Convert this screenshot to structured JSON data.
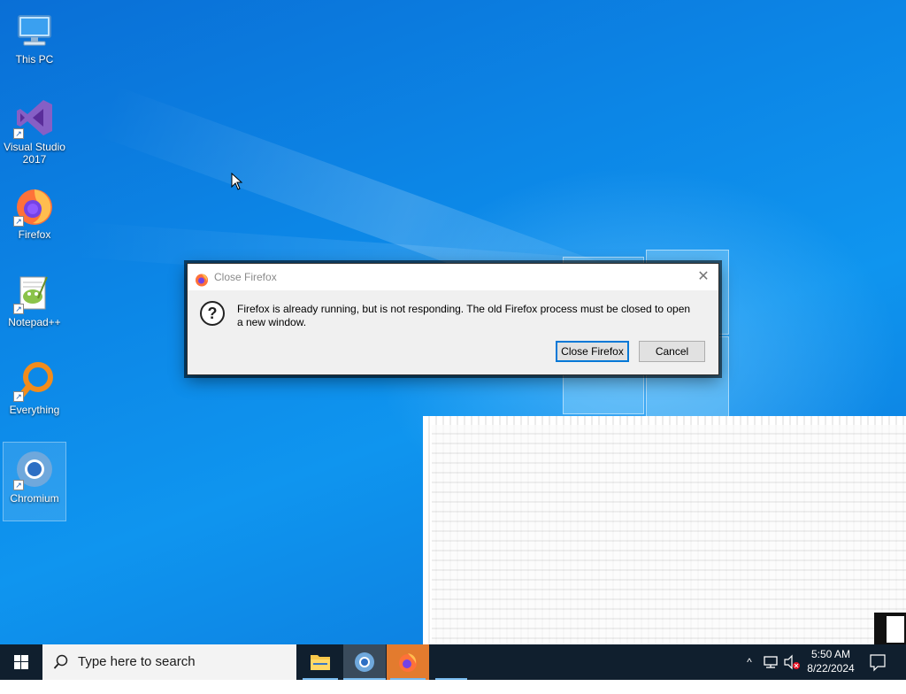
{
  "desktop": {
    "icons": [
      {
        "label": "This PC"
      },
      {
        "label": "Visual Studio 2017"
      },
      {
        "label": "Firefox"
      },
      {
        "label": "Notepad++"
      },
      {
        "label": "Everything"
      },
      {
        "label": "Chromium"
      }
    ]
  },
  "dialog": {
    "title": "Close Firefox",
    "message": "Firefox is already running, but is not responding. The old Firefox process must be closed to open a new window.",
    "primary_label": "Close Firefox",
    "cancel_label": "Cancel",
    "close_glyph": "✕",
    "question_glyph": "?"
  },
  "taskbar": {
    "search_placeholder": "Type here to search",
    "tray": {
      "chevron": "^",
      "time": "5:50 AM",
      "date": "8/22/2024"
    },
    "colors": {
      "background": "#101f2e",
      "accent": "#76b9ed"
    }
  }
}
